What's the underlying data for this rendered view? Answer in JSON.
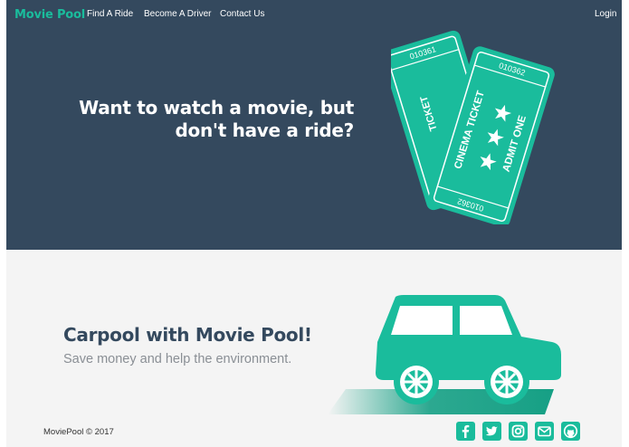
{
  "nav": {
    "brand": "Movie Pool",
    "links": [
      "Find A Ride",
      "Become A Driver",
      "Contact Us"
    ],
    "login": "Login"
  },
  "hero": {
    "title": "Want to watch a movie, but\ndon't have a ride?",
    "ticket_back": {
      "number_top": "010361",
      "label": "TICKET"
    },
    "ticket_front": {
      "number_top": "010362",
      "label_1": "CINEMA TICKET",
      "label_2": "ADMIT ONE",
      "number_bottom": "010362"
    }
  },
  "section2": {
    "title": "Carpool with Movie Pool!",
    "subtitle": "Save money and help the environment."
  },
  "footer": {
    "copyright": "MoviePool © 2017",
    "social": [
      "facebook-icon",
      "twitter-icon",
      "instagram-icon",
      "email-icon",
      "github-icon"
    ]
  },
  "colors": {
    "navy": "#34495e",
    "teal": "#1abc9c",
    "teal_dark": "#16a085",
    "light_bg": "#f4f4f4"
  }
}
